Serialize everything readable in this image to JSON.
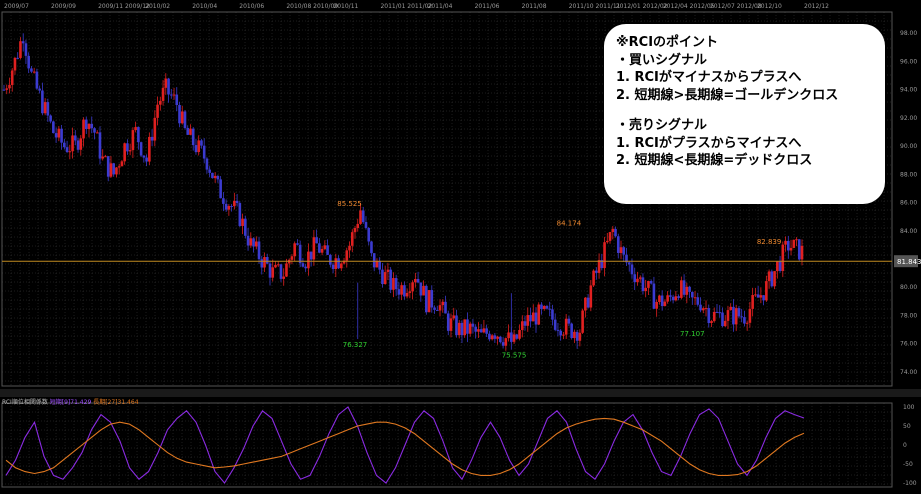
{
  "note": {
    "title": "※RCIのポイント",
    "buy_heading": "・買いシグナル",
    "buy_1": "1. RCIがマイナスからプラスへ",
    "buy_2": "2. 短期線>長期線=ゴールデンクロス",
    "sell_heading": "・売りシグナル",
    "sell_1": "1. RCIがプラスからマイナスへ",
    "sell_2": "2. 短期線<長期線=デッドクロス"
  },
  "indicator": {
    "name": "RCI順位相関係数",
    "short_label": "短期[9]",
    "short_value": "71.429",
    "long_label": "長期[27]",
    "long_value": "31.464"
  },
  "colors": {
    "up": "#e02020",
    "down": "#3b3bd0",
    "grid": "#3a3a3a",
    "axis_text": "#9a9a9a",
    "price_line": "#c08a20",
    "short_line": "#8a2be2",
    "long_line": "#e07820",
    "high_label": "#f08a30",
    "low_label": "#30d030"
  },
  "chart_data": {
    "type": "candlestick",
    "x_ticks": [
      "2009/07",
      "2009/09",
      "2009/11 2009/12",
      "2010/02",
      "2010/04",
      "2010/06",
      "2010/08 2010/09",
      "2010/11",
      "2011/01 2011/02",
      "2011/04",
      "2011/06",
      "2011/08",
      "2011/10 2011/11",
      "2012/01 2012/02",
      "2012/04 2012/05",
      "2012/07 2012/08",
      "2012/10",
      "2012/12"
    ],
    "ylim": [
      73,
      99.5
    ],
    "y_ticks": [
      74,
      76,
      78,
      80,
      82,
      84,
      86,
      88,
      90,
      92,
      94,
      96,
      98
    ],
    "current_price": 81.843,
    "annotations": [
      {
        "label": "85.525",
        "value": 85.525,
        "kind": "high"
      },
      {
        "label": "76.327",
        "value": 76.327,
        "kind": "low"
      },
      {
        "label": "75.575",
        "value": 75.575,
        "kind": "low"
      },
      {
        "label": "84.174",
        "value": 84.174,
        "kind": "high"
      },
      {
        "label": "77.107",
        "value": 77.107,
        "kind": "low"
      },
      {
        "label": "82.839",
        "value": 82.839,
        "kind": "high"
      }
    ],
    "price_path": [
      [
        0,
        94
      ],
      [
        4,
        96
      ],
      [
        7,
        98
      ],
      [
        10,
        95
      ],
      [
        14,
        93
      ],
      [
        18,
        91
      ],
      [
        22,
        90
      ],
      [
        26,
        90
      ],
      [
        30,
        92
      ],
      [
        33,
        91
      ],
      [
        36,
        89
      ],
      [
        40,
        88
      ],
      [
        44,
        90
      ],
      [
        48,
        91
      ],
      [
        52,
        89
      ],
      [
        56,
        93
      ],
      [
        59,
        94
      ],
      [
        63,
        93
      ],
      [
        66,
        91
      ],
      [
        70,
        90
      ],
      [
        74,
        89
      ],
      [
        78,
        87
      ],
      [
        82,
        86
      ],
      [
        86,
        85
      ],
      [
        90,
        83
      ],
      [
        94,
        82
      ],
      [
        98,
        81
      ],
      [
        102,
        81
      ],
      [
        106,
        83
      ],
      [
        110,
        82
      ],
      [
        114,
        83
      ],
      [
        118,
        82
      ],
      [
        122,
        82
      ],
      [
        126,
        83
      ],
      [
        130,
        85.5
      ],
      [
        134,
        82
      ],
      [
        138,
        81
      ],
      [
        142,
        80
      ],
      [
        146,
        80
      ],
      [
        150,
        81
      ],
      [
        154,
        79
      ],
      [
        158,
        79
      ],
      [
        162,
        77.5
      ],
      [
        166,
        77
      ],
      [
        170,
        77
      ],
      [
        174,
        76.5
      ],
      [
        178,
        77
      ],
      [
        182,
        76.5
      ],
      [
        186,
        76
      ],
      [
        190,
        77.5
      ],
      [
        194,
        78
      ],
      [
        198,
        78
      ],
      [
        202,
        77.5
      ],
      [
        206,
        77
      ],
      [
        210,
        77
      ],
      [
        214,
        80
      ],
      [
        218,
        82
      ],
      [
        222,
        84
      ],
      [
        226,
        82
      ],
      [
        230,
        81
      ],
      [
        234,
        80
      ],
      [
        238,
        79
      ],
      [
        242,
        79
      ],
      [
        246,
        80
      ],
      [
        250,
        79
      ],
      [
        254,
        79
      ],
      [
        258,
        78
      ],
      [
        262,
        78
      ],
      [
        266,
        78
      ],
      [
        270,
        78
      ],
      [
        274,
        79
      ],
      [
        278,
        80
      ],
      [
        282,
        81.5
      ],
      [
        286,
        83
      ],
      [
        291,
        82.5
      ]
    ],
    "ohlc_x": {
      "start": 0,
      "end": 291
    },
    "rci": {
      "ylim": [
        -100,
        100
      ],
      "y_ticks": [
        100,
        50,
        0,
        -50,
        -100
      ],
      "series": [
        {
          "name": "短期[9]",
          "values": [
            -80,
            -40,
            20,
            60,
            -30,
            -80,
            -90,
            -60,
            -20,
            40,
            80,
            60,
            10,
            -60,
            -90,
            -70,
            -20,
            40,
            70,
            90,
            60,
            0,
            -70,
            -100,
            -60,
            -10,
            50,
            90,
            70,
            10,
            -50,
            -90,
            -80,
            -30,
            30,
            80,
            100,
            50,
            -20,
            -80,
            -100,
            -60,
            0,
            60,
            90,
            70,
            10,
            -60,
            -90,
            -40,
            20,
            60,
            20,
            -40,
            -80,
            -50,
            10,
            70,
            90,
            60,
            -10,
            -70,
            -90,
            -50,
            10,
            60,
            80,
            40,
            -20,
            -70,
            -80,
            -30,
            30,
            80,
            95,
            70,
            10,
            -50,
            -80,
            -40,
            20,
            70,
            90,
            80,
            71
          ]
        },
        {
          "name": "長期[27]",
          "values": [
            -40,
            -60,
            -70,
            -75,
            -70,
            -60,
            -40,
            -20,
            0,
            20,
            40,
            55,
            60,
            55,
            40,
            20,
            0,
            -20,
            -35,
            -45,
            -50,
            -55,
            -60,
            -58,
            -55,
            -50,
            -45,
            -40,
            -35,
            -30,
            -20,
            -10,
            0,
            10,
            20,
            30,
            40,
            50,
            55,
            60,
            60,
            55,
            45,
            30,
            10,
            -10,
            -30,
            -50,
            -65,
            -75,
            -80,
            -80,
            -75,
            -65,
            -50,
            -30,
            -10,
            10,
            30,
            45,
            55,
            62,
            68,
            70,
            68,
            60,
            50,
            40,
            25,
            10,
            -10,
            -30,
            -50,
            -65,
            -75,
            -80,
            -80,
            -78,
            -70,
            -55,
            -35,
            -15,
            5,
            20,
            31
          ]
        }
      ]
    }
  }
}
